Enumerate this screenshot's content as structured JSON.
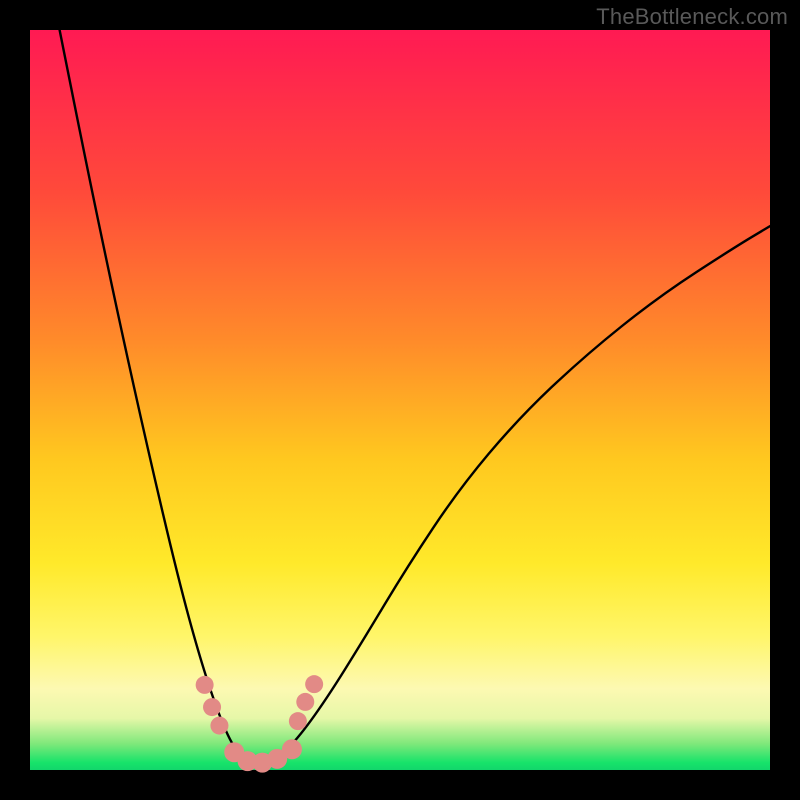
{
  "watermark": "TheBottleneck.com",
  "chart_data": {
    "type": "line",
    "title": "",
    "xlabel": "",
    "ylabel": "",
    "xlim": [
      0,
      1
    ],
    "ylim": [
      0,
      1
    ],
    "annotations": [],
    "gradient_stops": [
      {
        "pos": 0.0,
        "color": "#ff1a53"
      },
      {
        "pos": 0.22,
        "color": "#ff4a3a"
      },
      {
        "pos": 0.42,
        "color": "#ff8b2a"
      },
      {
        "pos": 0.58,
        "color": "#ffc81f"
      },
      {
        "pos": 0.72,
        "color": "#ffe92a"
      },
      {
        "pos": 0.82,
        "color": "#fff66a"
      },
      {
        "pos": 0.89,
        "color": "#fdf9b2"
      },
      {
        "pos": 0.93,
        "color": "#e6f7a8"
      },
      {
        "pos": 0.965,
        "color": "#7de87a"
      },
      {
        "pos": 0.99,
        "color": "#17e36a"
      },
      {
        "pos": 1.0,
        "color": "#12d66b"
      }
    ],
    "series": [
      {
        "name": "bottleneck-curve",
        "x": [
          0.04,
          0.08,
          0.12,
          0.16,
          0.2,
          0.23,
          0.255,
          0.275,
          0.295,
          0.31,
          0.33,
          0.36,
          0.4,
          0.45,
          0.51,
          0.58,
          0.66,
          0.75,
          0.85,
          0.95,
          1.0
        ],
        "y": [
          1.0,
          0.8,
          0.61,
          0.43,
          0.26,
          0.15,
          0.075,
          0.03,
          0.01,
          0.005,
          0.012,
          0.04,
          0.095,
          0.175,
          0.275,
          0.38,
          0.475,
          0.56,
          0.64,
          0.705,
          0.735
        ]
      }
    ],
    "markers": [
      {
        "name": "marker",
        "x": 0.236,
        "y": 0.115,
        "color": "#e28a86",
        "r": 9
      },
      {
        "name": "marker",
        "x": 0.246,
        "y": 0.085,
        "color": "#e28a86",
        "r": 9
      },
      {
        "name": "marker",
        "x": 0.256,
        "y": 0.06,
        "color": "#e28a86",
        "r": 9
      },
      {
        "name": "marker",
        "x": 0.276,
        "y": 0.024,
        "color": "#e28a86",
        "r": 10
      },
      {
        "name": "marker",
        "x": 0.294,
        "y": 0.012,
        "color": "#e28a86",
        "r": 10
      },
      {
        "name": "marker",
        "x": 0.314,
        "y": 0.01,
        "color": "#e28a86",
        "r": 10
      },
      {
        "name": "marker",
        "x": 0.334,
        "y": 0.015,
        "color": "#e28a86",
        "r": 10
      },
      {
        "name": "marker",
        "x": 0.354,
        "y": 0.028,
        "color": "#e28a86",
        "r": 10
      },
      {
        "name": "marker",
        "x": 0.362,
        "y": 0.066,
        "color": "#e28a86",
        "r": 9
      },
      {
        "name": "marker",
        "x": 0.372,
        "y": 0.092,
        "color": "#e28a86",
        "r": 9
      },
      {
        "name": "marker",
        "x": 0.384,
        "y": 0.116,
        "color": "#e28a86",
        "r": 9
      }
    ]
  }
}
